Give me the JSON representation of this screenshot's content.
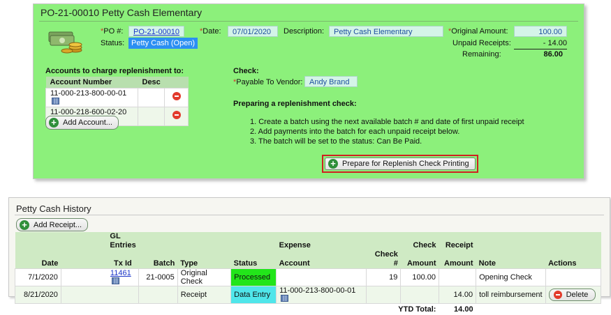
{
  "po": {
    "title": "PO-21-00010 Petty Cash Elementary",
    "po_label": "PO #:",
    "po_number": "PO-21-00010",
    "date_label": "Date:",
    "date": "07/01/2020",
    "description_label": "Description:",
    "description": "Petty Cash Elementary",
    "status_label": "Status:",
    "status": "Petty Cash (Open)",
    "original_amount_label": "Original Amount:",
    "original_amount": "100.00",
    "unpaid_receipts_label": "Unpaid Receipts:",
    "unpaid_receipts": "- 14.00",
    "remaining_label": "Remaining:",
    "remaining": "86.00"
  },
  "accounts": {
    "heading": "Accounts to charge replenishment to:",
    "col_account": "Account Number",
    "col_desc": "Desc",
    "rows": [
      {
        "account": "11-000-213-800-00-01",
        "desc": ""
      },
      {
        "account": "11-000-218-600-02-20",
        "desc": ""
      }
    ],
    "add_button": "Add Account..."
  },
  "check": {
    "heading": "Check:",
    "payable_label": "Payable To Vendor:",
    "vendor": "Andy Brand",
    "prep_heading": "Preparing a replenishment check:",
    "steps": [
      "1. Create a batch using the next available batch # and date of first unpaid receipt",
      "2. Add payments into the batch for each unpaid receipt below.",
      "3. The batch will be set to the status: Can Be Paid."
    ],
    "prepare_button": "Prepare for Replenish Check Printing"
  },
  "history": {
    "title": "Petty Cash History",
    "add_receipt_button": "Add Receipt...",
    "headers": {
      "date": "Date",
      "gl_entries": "GL Entries",
      "tx_id": "Tx Id",
      "batch": "Batch",
      "type": "Type",
      "status": "Status",
      "expense": "Expense",
      "account": "Account",
      "check_num": "Check #",
      "check": "Check",
      "amount": "Amount",
      "receipt": "Receipt",
      "receipt_amount": "Amount",
      "note": "Note",
      "actions": "Actions"
    },
    "rows": [
      {
        "date": "7/1/2020",
        "tx_id": "11461",
        "batch": "21-0005",
        "type": "Original Check",
        "status": "Processed",
        "account": "",
        "check_num": "19",
        "check_amount": "100.00",
        "receipt_amount": "",
        "note": "Opening Check",
        "action": ""
      },
      {
        "date": "8/21/2020",
        "tx_id": "",
        "batch": "",
        "type": "Receipt",
        "status": "Data Entry",
        "account": "11-000-213-800-00-01",
        "check_num": "",
        "check_amount": "",
        "receipt_amount": "14.00",
        "note": "toll reimbursement",
        "action": "Delete"
      }
    ],
    "ytd_label": "YTD Total:",
    "ytd_total": "14.00"
  },
  "colors": {
    "panel_green": "#8cf07b",
    "processed": "#22e51a",
    "data_entry": "#4fe6ea",
    "status_badge": "#2b8ff2",
    "highlight_border": "#d02020"
  }
}
